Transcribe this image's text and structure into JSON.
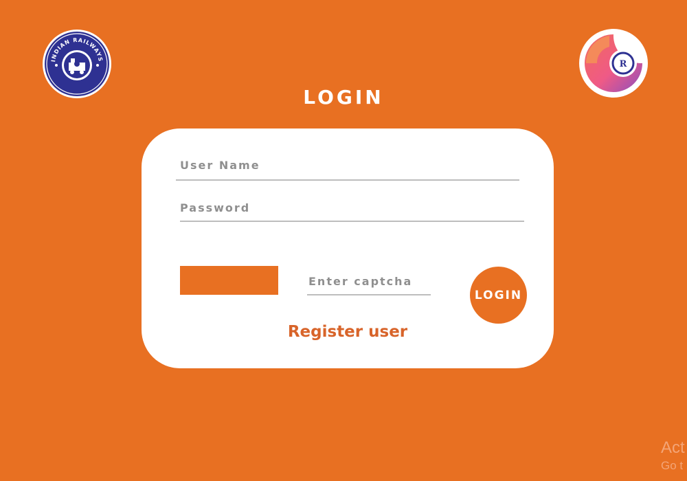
{
  "logos": {
    "left": {
      "name": "indian-railways-logo",
      "ring_text": "INDIAN RAILWAYS",
      "hindi_text": "भारतीय रेल",
      "color": "#2e3192"
    },
    "right": {
      "name": "irctc-logo",
      "gradient": [
        "#f26b5b",
        "#ef5a86",
        "#8b4fbf"
      ],
      "inner_color": "#2e3192"
    }
  },
  "page": {
    "title": "LOGIN",
    "background_color": "#e87022"
  },
  "form": {
    "username_placeholder": "User Name",
    "password_placeholder": "Password",
    "captcha_placeholder": "Enter captcha",
    "login_button_label": "LOGIN",
    "register_label": "Register user"
  },
  "watermark": {
    "line1": "Act",
    "line2": "Go t"
  }
}
